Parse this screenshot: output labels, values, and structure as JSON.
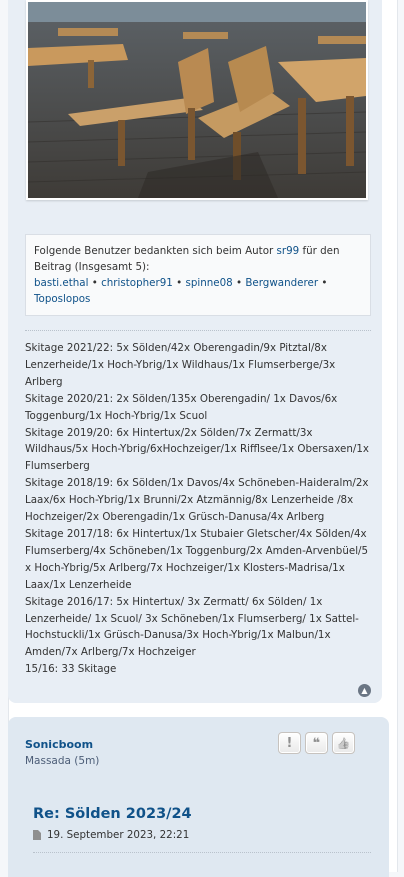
{
  "post1": {
    "image": {
      "alt": "wooden-benches-photo"
    },
    "thanks": {
      "prefix": "Folgende Benutzer bedankten sich beim Autor ",
      "author": "sr99",
      "suffix": " für den",
      "line2": "Beitrag (Insgesamt 5):",
      "users": [
        "basti.ethal",
        "christopher91",
        "spinne08",
        "Bergwanderer",
        "Toposlopos"
      ],
      "separator": "•"
    },
    "signature_lines": [
      "Skitage 2021/22: 5x Sölden/42x Oberengadin/9x Pitztal/8x",
      "Lenzerheide/1x Hoch-Ybrig/1x Wildhaus/1x Flumserberge/3x",
      "Arlberg",
      "Skitage 2020/21: 2x Sölden/135x Oberengadin/ 1x Davos/6x",
      "Toggenburg/1x Hoch-Ybrig/1x Scuol",
      "Skitage 2019/20: 6x Hintertux/2x Sölden/7x Zermatt/3x",
      "Wildhaus/5x Hoch-Ybrig/6xHochzeiger/1x Rifflsee/1x Obersaxen/1x",
      "Flumserberg",
      "Skitage 2018/19: 6x Sölden/1x Davos/4x Schöneben-Haideralm/2x",
      "Laax/6x Hoch-Ybrig/1x Brunni/2x Atzmännig/8x Lenzerheide /8x",
      "Hochzeiger/2x Oberengadin/1x Grüsch-Danusa/4x Arlberg",
      "Skitage 2017/18: 6x Hintertux/1x Stubaier Gletscher/4x Sölden/4x",
      "Flumserberg/4x Schöneben/1x Toggenburg/2x Amden-Arvenbüel/5",
      "x Hoch-Ybrig/5x Arlberg/7x Hochzeiger/1x Klosters-Madrisa/1x",
      "Laax/1x Lenzerheide",
      "Skitage 2016/17: 5x Hintertux/ 3x Zermatt/ 6x Sölden/ 1x",
      "Lenzerheide/ 1x Scuol/ 3x Schöneben/1x Flumserberg/ 1x Sattel-",
      "Hochstuckli/1x Grüsch-Danusa/3x Hoch-Ybrig/1x Malbun/1x",
      "Amden/7x Arlberg/7x Hochzeiger",
      "15/16: 33 Skitage"
    ],
    "back_to_top_icon": "chevron-up-circle"
  },
  "post2": {
    "author": "Sonicboom",
    "rank": "Massada (5m)",
    "buttons": [
      {
        "label": "!",
        "icon": "report-icon"
      },
      {
        "label": "❝",
        "icon": "quote-icon"
      },
      {
        "label": "👍",
        "icon": "thumbs-up-icon"
      }
    ],
    "title": "Re: Sölden 2023/24",
    "date": "19. September 2023, 22:21"
  },
  "colors": {
    "link": "#105289",
    "post_bg": "#e8eef5",
    "post2_bg": "#dfe8f1"
  }
}
